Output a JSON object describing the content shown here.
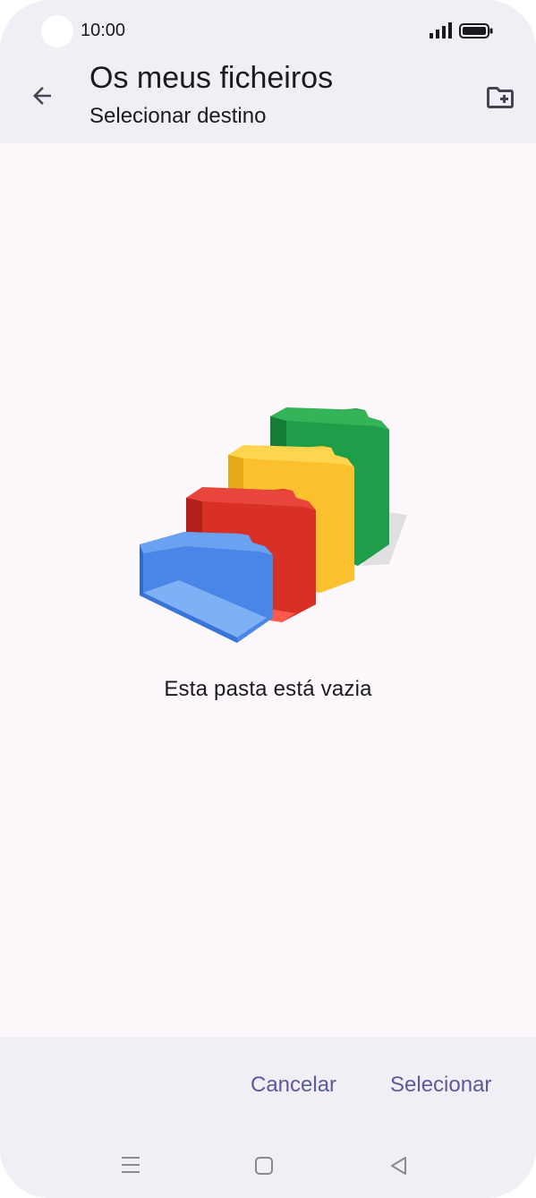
{
  "status_bar": {
    "time": "10:00"
  },
  "app_bar": {
    "title": "Os meus ficheiros",
    "subtitle": "Selecionar destino",
    "back_icon": "arrow-back-icon",
    "new_folder_icon": "folder-add-icon"
  },
  "content": {
    "empty_message": "Esta pasta está vazia",
    "illustration": "empty-folders-illustration"
  },
  "actions": {
    "cancel_label": "Cancelar",
    "select_label": "Selecionar"
  },
  "colors": {
    "surface": "#fcf8fc",
    "bar": "#f1eef6",
    "accent": "#5b5a9a",
    "folder_blue": "#4a86e8",
    "folder_red": "#d93025",
    "folder_yellow": "#fbc02d",
    "folder_green": "#1e9e48"
  }
}
